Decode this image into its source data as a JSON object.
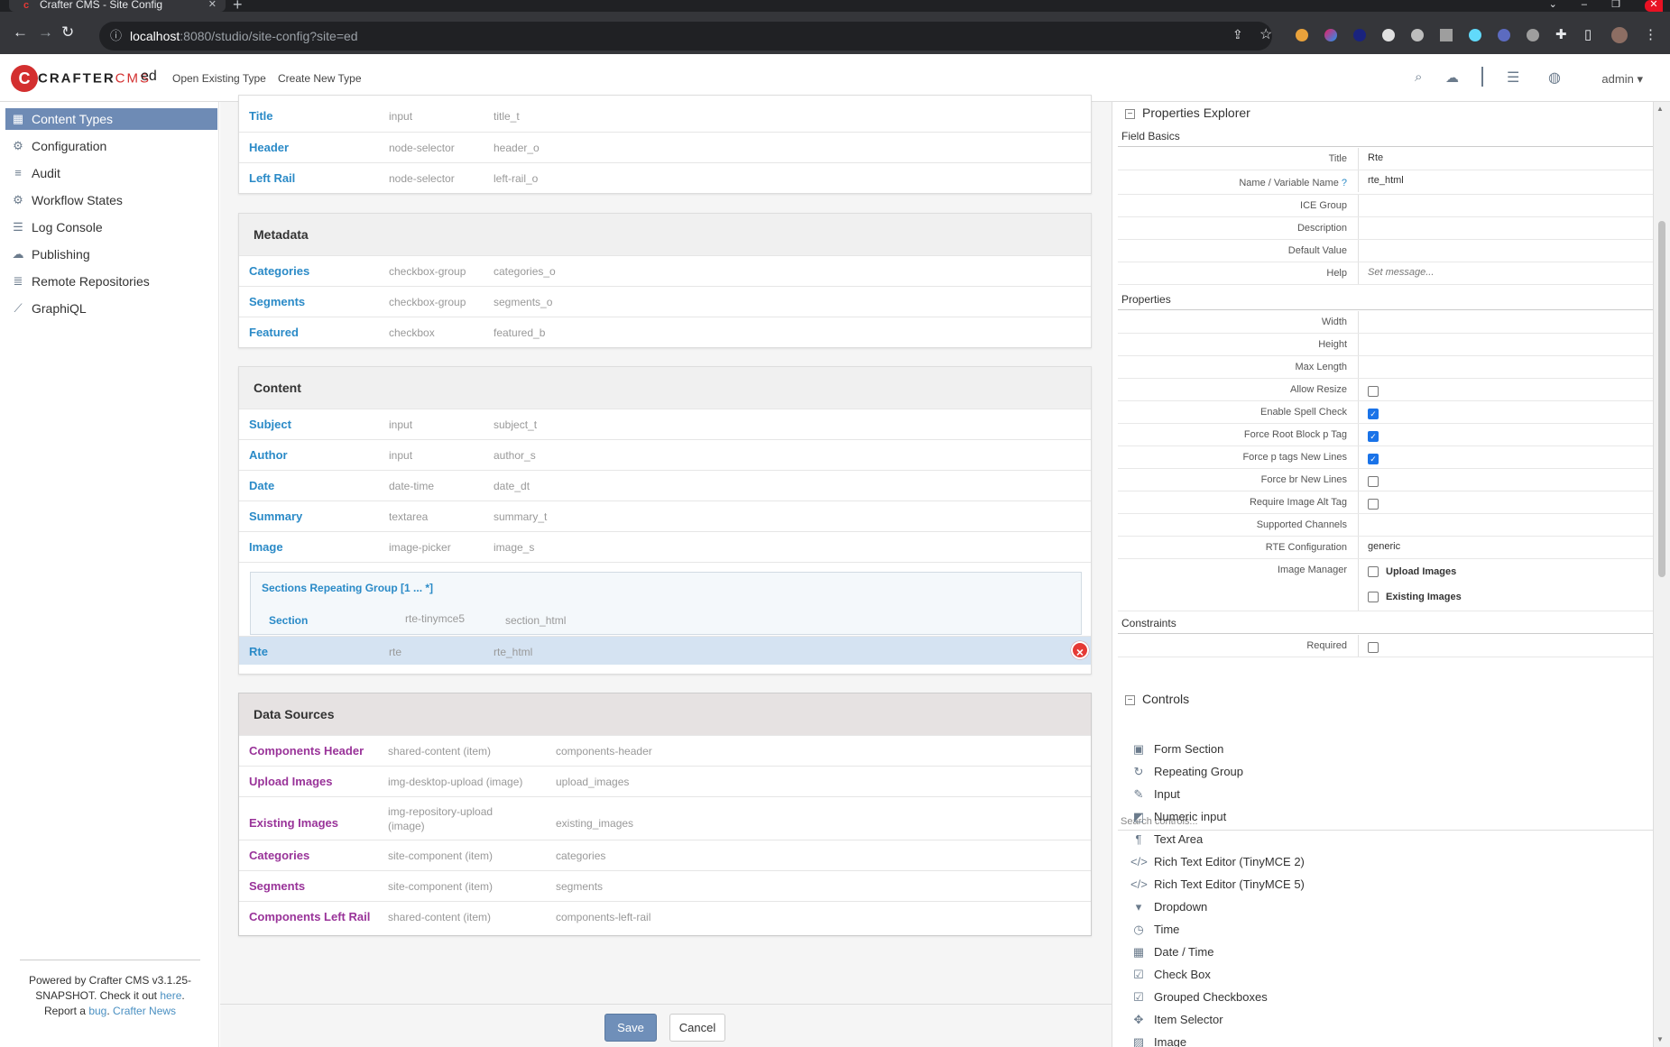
{
  "browser": {
    "tab_title": "Crafter CMS - Site Config",
    "tab_icon": "crafter-favicon",
    "url_host": "localhost",
    "url_rest": ":8080/studio/site-config?site=ed"
  },
  "header": {
    "logo_crafter": "CRAFTER",
    "logo_cms": "CMS",
    "site": "ed",
    "links": [
      "Open Existing Type",
      "Create New Type"
    ],
    "user": "admin"
  },
  "sidebar": {
    "items": [
      {
        "label": "Content Types",
        "icon": "grid-icon"
      },
      {
        "label": "Configuration",
        "icon": "gear-icon"
      },
      {
        "label": "Audit",
        "icon": "list-icon"
      },
      {
        "label": "Workflow States",
        "icon": "gear-icon"
      },
      {
        "label": "Log Console",
        "icon": "log-icon"
      },
      {
        "label": "Publishing",
        "icon": "cloud-icon"
      },
      {
        "label": "Remote Repositories",
        "icon": "database-icon"
      },
      {
        "label": "GraphiQL",
        "icon": "chart-icon"
      }
    ],
    "footer": {
      "line1": "Powered by Crafter CMS v3.1.25-SNAPSHOT. Check it out",
      "here": "here",
      "report": "Report a",
      "bug": "bug",
      "news": "Crafter News"
    }
  },
  "sections": {
    "top_fields": [
      {
        "label": "Title",
        "type": "input",
        "var": "title_t"
      },
      {
        "label": "Header",
        "type": "node-selector",
        "var": "header_o"
      },
      {
        "label": "Left Rail",
        "type": "node-selector",
        "var": "left-rail_o"
      }
    ],
    "metadata": {
      "title": "Metadata",
      "fields": [
        {
          "label": "Categories",
          "type": "checkbox-group",
          "var": "categories_o"
        },
        {
          "label": "Segments",
          "type": "checkbox-group",
          "var": "segments_o"
        },
        {
          "label": "Featured",
          "type": "checkbox",
          "var": "featured_b"
        }
      ]
    },
    "content": {
      "title": "Content",
      "fields": [
        {
          "label": "Subject",
          "type": "input",
          "var": "subject_t"
        },
        {
          "label": "Author",
          "type": "input",
          "var": "author_s"
        },
        {
          "label": "Date",
          "type": "date-time",
          "var": "date_dt"
        },
        {
          "label": "Summary",
          "type": "textarea",
          "var": "summary_t"
        },
        {
          "label": "Image",
          "type": "image-picker",
          "var": "image_s"
        }
      ],
      "repeating_group": {
        "title": "Sections Repeating Group [1 ... *]",
        "field": {
          "label": "Section",
          "type": "rte-tinymce5",
          "var": "section_html"
        }
      },
      "selected_field": {
        "label": "Rte",
        "type": "rte",
        "var": "rte_html"
      }
    },
    "datasources": {
      "title": "Data Sources",
      "items": [
        {
          "label": "Components Header",
          "type": "shared-content (item)",
          "var": "components-header"
        },
        {
          "label": "Upload Images",
          "type": "img-desktop-upload (image)",
          "var": "upload_images"
        },
        {
          "label": "Existing Images",
          "type": "img-repository-upload (image)",
          "var": "existing_images"
        },
        {
          "label": "Categories",
          "type": "site-component (item)",
          "var": "categories"
        },
        {
          "label": "Segments",
          "type": "site-component (item)",
          "var": "segments"
        },
        {
          "label": "Components Left Rail",
          "type": "shared-content (item)",
          "var": "components-left-rail"
        }
      ]
    }
  },
  "actions": {
    "save": "Save",
    "cancel": "Cancel"
  },
  "properties": {
    "title": "Properties Explorer",
    "field_basics_label": "Field Basics",
    "field_basics": [
      {
        "label": "Title",
        "value": "Rte"
      },
      {
        "label": "Name / Variable Name",
        "value": "rte_html"
      },
      {
        "label": "ICE Group",
        "value": ""
      },
      {
        "label": "Description",
        "value": ""
      },
      {
        "label": "Default Value",
        "value": ""
      },
      {
        "label": "Help",
        "value": "Set message..."
      }
    ],
    "properties_label": "Properties",
    "props": [
      {
        "label": "Width",
        "value": ""
      },
      {
        "label": "Height",
        "value": ""
      },
      {
        "label": "Max Length",
        "value": ""
      },
      {
        "label": "Allow Resize",
        "checked": false
      },
      {
        "label": "Enable Spell Check",
        "checked": true
      },
      {
        "label": "Force Root Block p Tag",
        "checked": true
      },
      {
        "label": "Force p tags New Lines",
        "checked": true
      },
      {
        "label": "Force br New Lines",
        "checked": false
      },
      {
        "label": "Require Image Alt Tag",
        "checked": false
      },
      {
        "label": "Supported Channels",
        "value": ""
      },
      {
        "label": "RTE Configuration",
        "value": "generic"
      }
    ],
    "image_manager": {
      "label": "Image Manager",
      "options": [
        "Upload Images",
        "Existing Images"
      ]
    },
    "constraints_label": "Constraints",
    "required_label": "Required"
  },
  "controls": {
    "title": "Controls",
    "search_placeholder": "Search controls...",
    "items": [
      {
        "label": "Form Section",
        "icon": "form-section-icon"
      },
      {
        "label": "Repeating Group",
        "icon": "repeat-icon"
      },
      {
        "label": "Input",
        "icon": "pencil-icon"
      },
      {
        "label": "Numeric input",
        "icon": "numeric-icon"
      },
      {
        "label": "Text Area",
        "icon": "paragraph-icon"
      },
      {
        "label": "Rich Text Editor (TinyMCE 2)",
        "icon": "code-icon"
      },
      {
        "label": "Rich Text Editor (TinyMCE 5)",
        "icon": "code-icon"
      },
      {
        "label": "Dropdown",
        "icon": "caret-down-icon"
      },
      {
        "label": "Time",
        "icon": "clock-icon"
      },
      {
        "label": "Date / Time",
        "icon": "calendar-icon"
      },
      {
        "label": "Check Box",
        "icon": "checkbox-icon"
      },
      {
        "label": "Grouped Checkboxes",
        "icon": "checkbox-icon"
      },
      {
        "label": "Item Selector",
        "icon": "crosshair-icon"
      },
      {
        "label": "Image",
        "icon": "image-icon"
      }
    ]
  }
}
